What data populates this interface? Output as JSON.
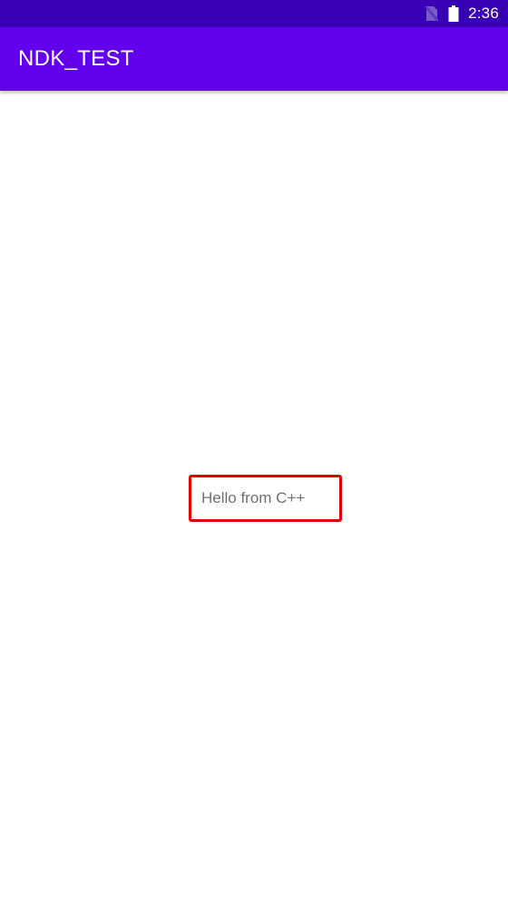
{
  "status_bar": {
    "time": "2:36",
    "icons": [
      "no-sim-icon",
      "battery-icon"
    ]
  },
  "app_bar": {
    "title": "NDK_TEST"
  },
  "content": {
    "message": "Hello from C++"
  },
  "colors": {
    "status_bar": "#3700b3",
    "app_bar": "#6200ee",
    "highlight_border": "#e00000",
    "message_text": "#6f6f6f"
  }
}
